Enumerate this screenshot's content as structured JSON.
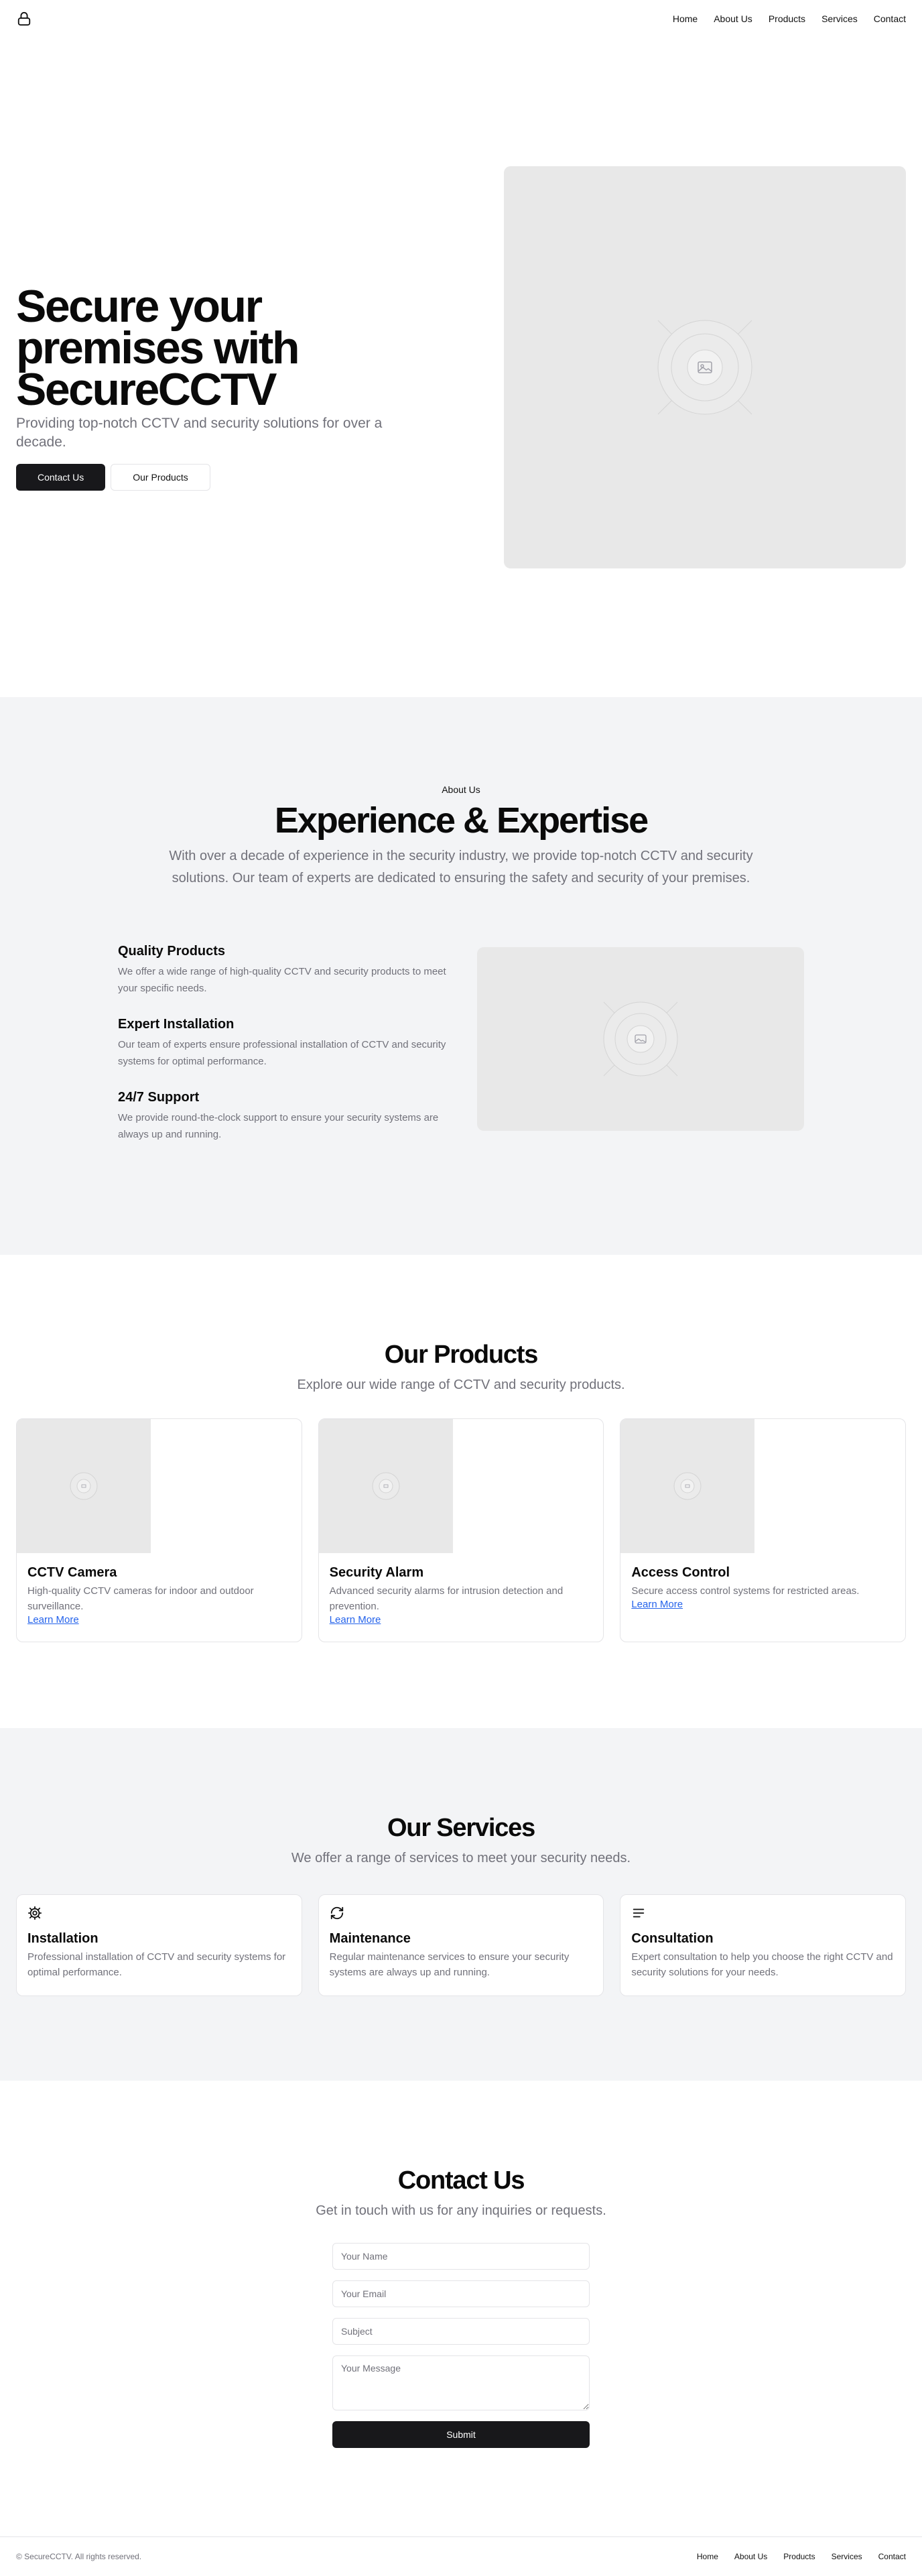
{
  "nav": {
    "items": [
      "Home",
      "About Us",
      "Products",
      "Services",
      "Contact"
    ]
  },
  "hero": {
    "title": "Secure your premises with SecureCCTV",
    "subtitle": "Providing top-notch CCTV and security solutions for over a decade.",
    "primary_button": "Contact Us",
    "secondary_button": "Our Products"
  },
  "about": {
    "eyebrow": "About Us",
    "title": "Experience & Expertise",
    "subtitle": "With over a decade of experience in the security industry, we provide top-notch CCTV and security solutions. Our team of experts are dedicated to ensuring the safety and security of your premises.",
    "features": [
      {
        "title": "Quality Products",
        "text": "We offer a wide range of high-quality CCTV and security products to meet your specific needs."
      },
      {
        "title": "Expert Installation",
        "text": "Our team of experts ensure professional installation of CCTV and security systems for optimal performance."
      },
      {
        "title": "24/7 Support",
        "text": "We provide round-the-clock support to ensure your security systems are always up and running."
      }
    ]
  },
  "products": {
    "title": "Our Products",
    "subtitle": "Explore our wide range of CCTV and security products.",
    "items": [
      {
        "title": "CCTV Camera",
        "text": "High-quality CCTV cameras for indoor and outdoor surveillance.",
        "link": "Learn More"
      },
      {
        "title": "Security Alarm",
        "text": "Advanced security alarms for intrusion detection and prevention.",
        "link": "Learn More"
      },
      {
        "title": "Access Control",
        "text": "Secure access control systems for restricted areas.",
        "link": "Learn More"
      }
    ]
  },
  "services": {
    "title": "Our Services",
    "subtitle": "We offer a range of services to meet your security needs.",
    "items": [
      {
        "icon": "gear-icon",
        "title": "Installation",
        "text": "Professional installation of CCTV and security systems for optimal performance."
      },
      {
        "icon": "refresh-icon",
        "title": "Maintenance",
        "text": "Regular maintenance services to ensure your security systems are always up and running."
      },
      {
        "icon": "list-icon",
        "title": "Consultation",
        "text": "Expert consultation to help you choose the right CCTV and security solutions for your needs."
      }
    ]
  },
  "contact": {
    "title": "Contact Us",
    "subtitle": "Get in touch with us for any inquiries or requests.",
    "name_placeholder": "Your Name",
    "email_placeholder": "Your Email",
    "subject_placeholder": "Subject",
    "message_placeholder": "Your Message",
    "submit": "Submit"
  },
  "footer": {
    "copyright": "© SecureCCTV. All rights reserved.",
    "links": [
      "Home",
      "About Us",
      "Products",
      "Services",
      "Contact"
    ]
  },
  "colors": {
    "primary": "#18181b",
    "muted_text": "#71717a",
    "section_bg": "#f3f4f6",
    "link": "#2563eb"
  }
}
